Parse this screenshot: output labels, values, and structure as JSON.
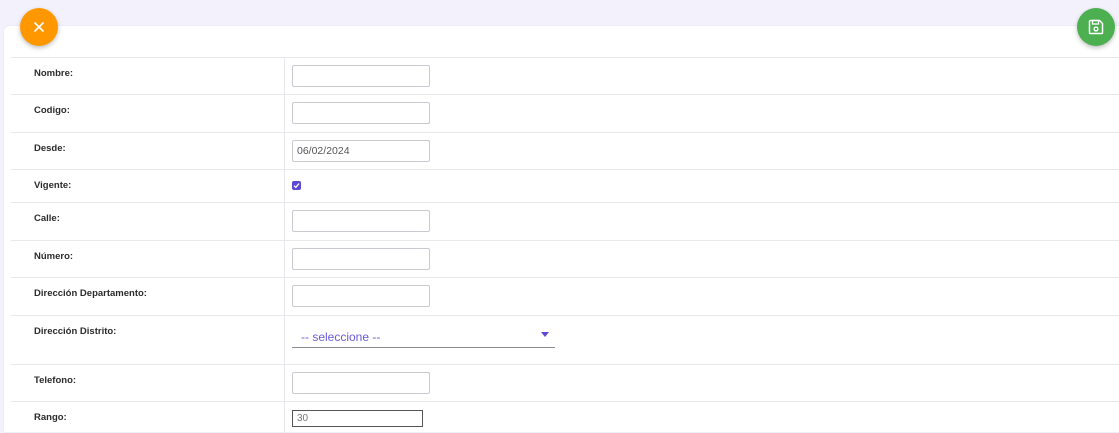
{
  "colors": {
    "close": "#ff9800",
    "save": "#4caf50",
    "accent": "#5b49d4"
  },
  "actions": {
    "close_icon": "close-icon",
    "save_icon": "floppy-disk-icon"
  },
  "form": {
    "nombre": {
      "label": "Nombre:",
      "value": ""
    },
    "codigo": {
      "label": "Codigo:",
      "value": ""
    },
    "desde": {
      "label": "Desde:",
      "value": "06/02/2024"
    },
    "vigente": {
      "label": "Vigente:",
      "checked": true
    },
    "calle": {
      "label": "Calle:",
      "value": ""
    },
    "numero": {
      "label": "Número:",
      "value": ""
    },
    "direccion_departamento": {
      "label": "Dirección Departamento:",
      "value": ""
    },
    "direccion_distrito": {
      "label": "Dirección Distrito:",
      "selected": "-- seleccione --"
    },
    "telefono": {
      "label": "Telefono:",
      "value": ""
    },
    "rango": {
      "label": "Rango:",
      "value": "30"
    }
  }
}
